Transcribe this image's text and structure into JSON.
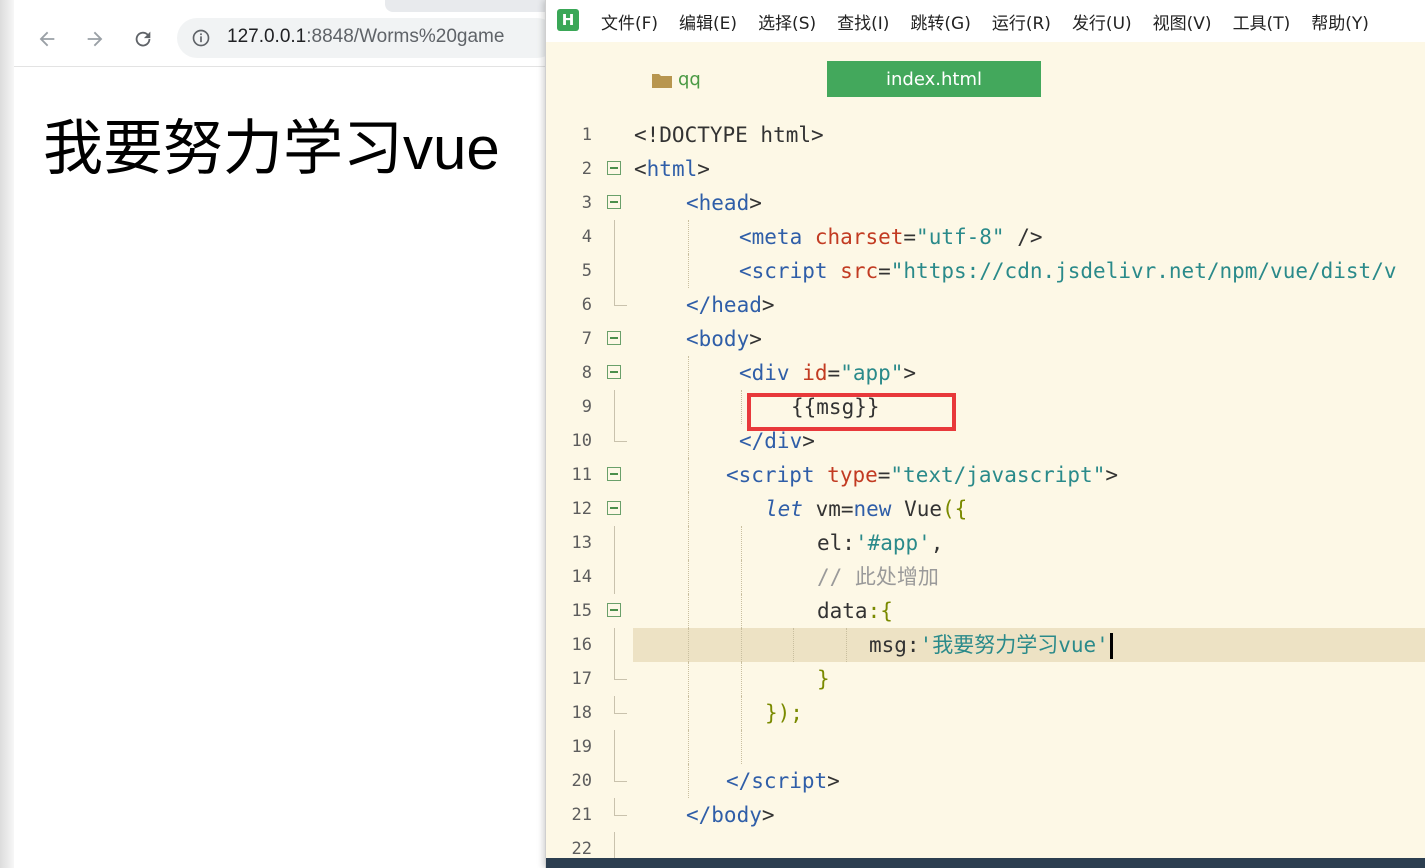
{
  "browser": {
    "url_host": "127.0.0.1",
    "url_rest": ":8848/Worms%20game",
    "page_heading": "我要努力学习vue"
  },
  "editor": {
    "logo": "H",
    "menu": [
      "文件(F)",
      "编辑(E)",
      "选择(S)",
      "查找(I)",
      "跳转(G)",
      "运行(R)",
      "发行(U)",
      "视图(V)",
      "工具(T)",
      "帮助(Y)"
    ],
    "folder_name": "qq",
    "active_tab": "index.html",
    "line_numbers": [
      "1",
      "2",
      "3",
      "4",
      "5",
      "6",
      "7",
      "8",
      "9",
      "10",
      "11",
      "12",
      "13",
      "14",
      "15",
      "16",
      "17",
      "18",
      "19",
      "20",
      "21",
      "22"
    ],
    "code": {
      "l1": "<!DOCTYPE html>",
      "l2_open": "<",
      "l2_tag": "html",
      "l2_close": ">",
      "l3_tag": "<head",
      "l3_close": ">",
      "l4_tag": "<meta",
      "l4_attr": "charset",
      "l4_eq": "=",
      "l4_val": "\"utf-8\"",
      "l4_end": " />",
      "l5_tag": "<script",
      "l5_attr": "src",
      "l5_eq": "=",
      "l5_val": "\"https://cdn.jsdelivr.net/npm/vue/dist/v",
      "l6_tag": "</head",
      "l6_close": ">",
      "l7_tag": "<body",
      "l7_close": ">",
      "l8_tag": "<div",
      "l8_attr": "id",
      "l8_eq": "=",
      "l8_val": "\"app\"",
      "l8_close": ">",
      "l9": "{{msg}}",
      "l10_tag": "</div",
      "l10_close": ">",
      "l11_tag": "<script",
      "l11_attr": "type",
      "l11_eq": "=",
      "l11_val": "\"text/javascript\"",
      "l11_close": ">",
      "l12_kw": "let",
      "l12_a": " vm=",
      "l12_new": "new",
      "l12_b": " Vue",
      "l12_brace": "({",
      "l13_key": "el:",
      "l13_val": "'#app'",
      "l13_end": ",",
      "l14": "// 此处增加",
      "l15_key": "data",
      "l15_brace": ":{",
      "l16_key": "msg:",
      "l16_val": "'我要努力学习vue'",
      "l17": "}",
      "l18": "});",
      "l20_tag": "</script",
      "l20_close": ">",
      "l21_tag": "</body",
      "l21_close": ">"
    }
  }
}
